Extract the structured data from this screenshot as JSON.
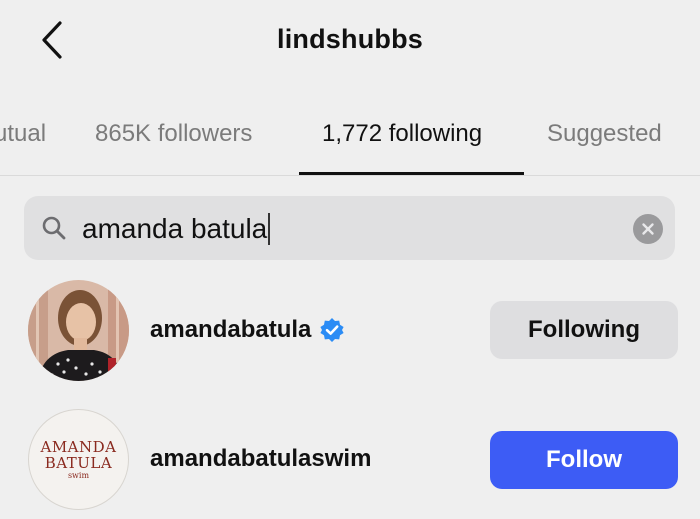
{
  "header": {
    "title": "lindshubbs",
    "back_icon": "chevron-left-icon"
  },
  "tabs": [
    {
      "label": "utual"
    },
    {
      "label": "865K followers"
    },
    {
      "label": "1,772 following",
      "active": true
    },
    {
      "label": "Suggested"
    }
  ],
  "search": {
    "value": "amanda batula",
    "icon": "search-icon",
    "clear_icon": "clear-icon"
  },
  "results": [
    {
      "username": "amandabatula",
      "verified": true,
      "button_label": "Following"
    },
    {
      "username": "amandabatulaswim",
      "verified": false,
      "button_label": "Follow",
      "logo_lines": [
        "AMANDA",
        "BATULA",
        "swim"
      ]
    }
  ],
  "colors": {
    "background": "#efefef",
    "follow_button": "#3d5cf5",
    "following_button": "#dedee0",
    "verified_badge": "#2b8cf5"
  }
}
